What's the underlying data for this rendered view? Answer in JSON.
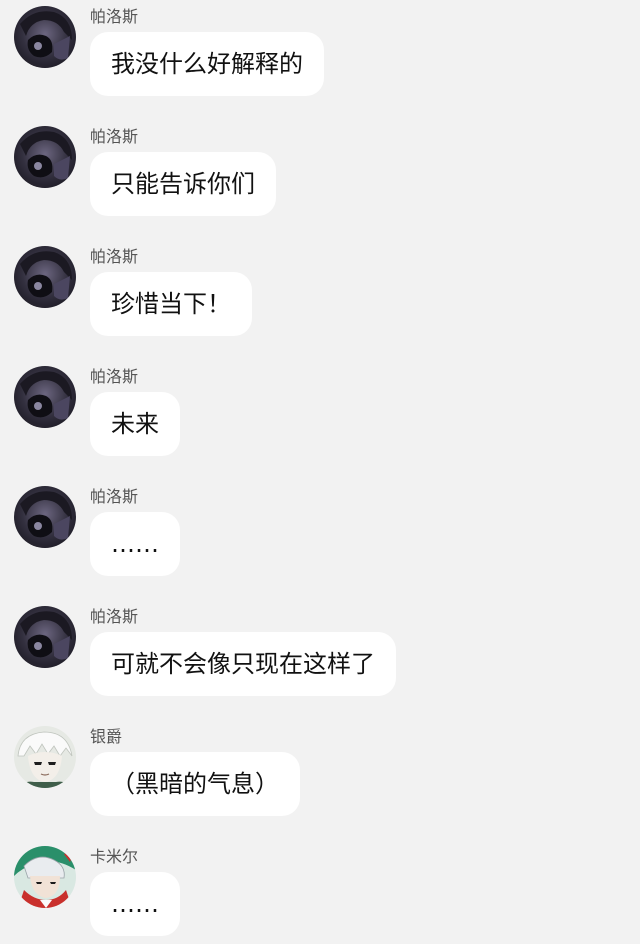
{
  "colors": {
    "background": "#f2f2f2",
    "bubble": "#ffffff",
    "sender_name": "#555555",
    "message_text": "#111111"
  },
  "messages": [
    {
      "sender": "帕洛斯",
      "avatar": "dark-hooded-character-avatar",
      "text": "我没什么好解释的"
    },
    {
      "sender": "帕洛斯",
      "avatar": "dark-hooded-character-avatar",
      "text": "只能告诉你们"
    },
    {
      "sender": "帕洛斯",
      "avatar": "dark-hooded-character-avatar",
      "text": "珍惜当下！"
    },
    {
      "sender": "帕洛斯",
      "avatar": "dark-hooded-character-avatar",
      "text": "未来"
    },
    {
      "sender": "帕洛斯",
      "avatar": "dark-hooded-character-avatar",
      "text": "……"
    },
    {
      "sender": "帕洛斯",
      "avatar": "dark-hooded-character-avatar",
      "text": "可就不会像只现在这样了"
    },
    {
      "sender": "银爵",
      "avatar": "white-haired-character-avatar",
      "text": "（黑暗的气息）"
    },
    {
      "sender": "卡米尔",
      "avatar": "red-green-character-avatar",
      "text": "……"
    }
  ]
}
